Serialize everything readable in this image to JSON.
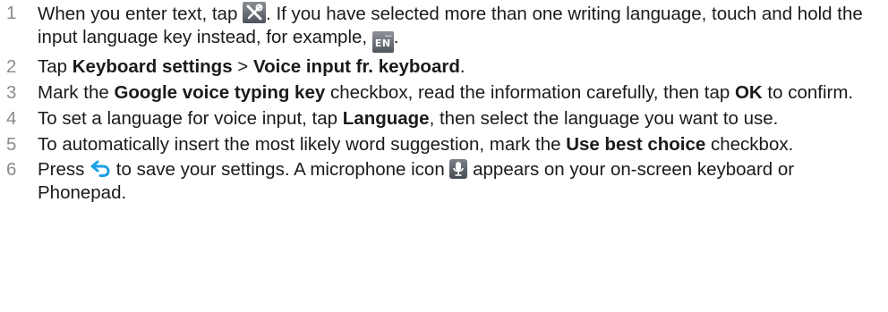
{
  "steps": [
    {
      "num": "1",
      "t1": "When you enter text, tap ",
      "t2": ". If you have selected more than one writing language, touch and hold the input language key instead, for example, ",
      "t3": ".",
      "icon_settings": "tools-settings-icon",
      "icon_lang": "input-language-key-icon",
      "lang_key_text": "EN",
      "lang_key_dots": "..."
    },
    {
      "num": "2",
      "t1": "Tap ",
      "b1": "Keyboard settings",
      "t2": " > ",
      "b2": "Voice input fr. keyboard",
      "t3": "."
    },
    {
      "num": "3",
      "t1": "Mark the ",
      "b1": "Google voice typing key",
      "t2": " checkbox, read the information carefully, then tap ",
      "b2": "OK",
      "t3": " to confirm."
    },
    {
      "num": "4",
      "t1": "To set a language for voice input, tap ",
      "b1": "Language",
      "t2": ", then select the language you want to use."
    },
    {
      "num": "5",
      "t1": "To automatically insert the most likely word suggestion, mark the ",
      "b1": "Use best choice",
      "t2": " checkbox."
    },
    {
      "num": "6",
      "t1": "Press ",
      "t2": " to save your settings. A microphone icon ",
      "t3": " appears on your on-screen keyboard or Phonepad.",
      "icon_back": "back-arrow-icon",
      "icon_mic": "microphone-icon"
    }
  ],
  "colors": {
    "step_number": "#8c8c8c",
    "text": "#1a1a1a",
    "back_arrow": "#1ba1e2",
    "icon_key": "#4d535a"
  }
}
